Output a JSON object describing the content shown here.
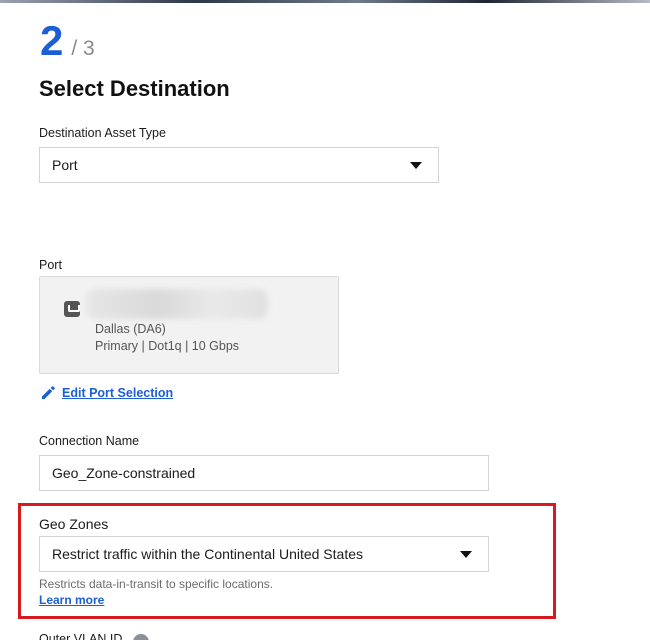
{
  "stepper": {
    "current": "2",
    "total": "/ 3"
  },
  "page_title": "Select Destination",
  "destination_asset_type": {
    "label": "Destination Asset Type",
    "value": "Port"
  },
  "port": {
    "label": "Port",
    "location": "Dallas (DA6)",
    "details": "Primary | Dot1q | 10 Gbps",
    "edit_label": "Edit Port Selection"
  },
  "connection_name": {
    "label": "Connection Name",
    "value": "Geo_Zone-constrained"
  },
  "geo_zones": {
    "label": "Geo Zones",
    "value": "Restrict traffic within the Continental United States",
    "helper": "Restricts data-in-transit to specific locations.",
    "learn_more": "Learn more"
  },
  "next_field": {
    "label": "Outer VLAN ID"
  },
  "colors": {
    "accent": "#1c5ed6",
    "highlight": "#d71920"
  }
}
